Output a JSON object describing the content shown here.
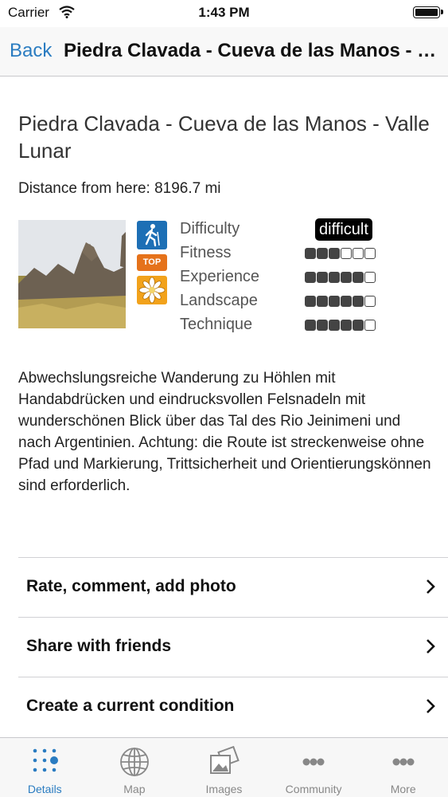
{
  "status_bar": {
    "carrier": "Carrier",
    "time": "1:43 PM"
  },
  "nav": {
    "back_label": "Back",
    "title": "Piedra Clavada - Cueva de las Manos - Valle Lunar"
  },
  "route": {
    "title": "Piedra Clavada - Cueva de las Manos - Valle Lunar",
    "distance": "Distance from here: 8196.7 mi",
    "badges": [
      "hiking-icon",
      "TOP",
      "edelweiss-icon"
    ],
    "difficulty_label": "Difficulty",
    "difficulty_value": "difficult",
    "ratings": [
      {
        "label": "Fitness",
        "value": 3,
        "max": 6
      },
      {
        "label": "Experience",
        "value": 5,
        "max": 6
      },
      {
        "label": "Landscape",
        "value": 5,
        "max": 6
      },
      {
        "label": "Technique",
        "value": 5,
        "max": 6
      }
    ],
    "description": "Abwechslungsreiche Wanderung zu Höhlen mit Handabdrücken und eindrucksvollen Felsnadeln mit wunderschönen Blick über das Tal des Rio Jeinimeni und nach Argentinien. Achtung: die Route ist streckenweise ohne Pfad und Markierung, Trittsicherheit und Orientierungskönnen sind erforderlich."
  },
  "actions": [
    {
      "label": "Rate, comment, add photo"
    },
    {
      "label": "Share with friends"
    },
    {
      "label": "Create a current condition"
    }
  ],
  "tabs": [
    {
      "label": "Details",
      "icon": "details-dots-icon",
      "active": true
    },
    {
      "label": "Map",
      "icon": "globe-icon",
      "active": false
    },
    {
      "label": "Images",
      "icon": "images-icon",
      "active": false
    },
    {
      "label": "Community",
      "icon": "community-icon",
      "active": false
    },
    {
      "label": "More",
      "icon": "more-icon",
      "active": false
    }
  ],
  "colors": {
    "accent": "#2a7cc1",
    "hike_badge": "#1d6fb5",
    "top_badge": "#e5721b",
    "edelweiss_badge": "#f2a21b"
  }
}
